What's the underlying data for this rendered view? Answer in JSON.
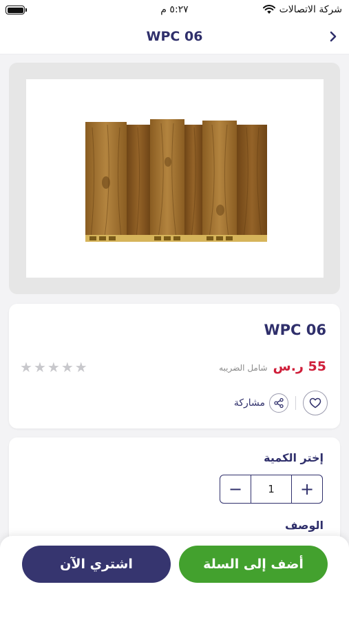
{
  "status": {
    "carrier": "شركة الاتصالات",
    "time": "٥:٢٧ م"
  },
  "nav": {
    "title": "WPC 06",
    "back_icon": "chevron-right-icon"
  },
  "product": {
    "title": "WPC 06",
    "price": "55 ر.س",
    "tax_note": "شامل الضريبه",
    "rating": 0,
    "rating_max": 5,
    "share_label": "مشاركة"
  },
  "quantity": {
    "label": "إختر الكمية",
    "value": "1",
    "minus": "−",
    "plus": "+"
  },
  "description": {
    "label": "الوصف"
  },
  "buttons": {
    "add_to_cart": "أضف إلى السلة",
    "buy_now": "اشتري الآن"
  },
  "colors": {
    "primary": "#36356f",
    "green": "#43a12e",
    "price": "#cf1f3a"
  }
}
